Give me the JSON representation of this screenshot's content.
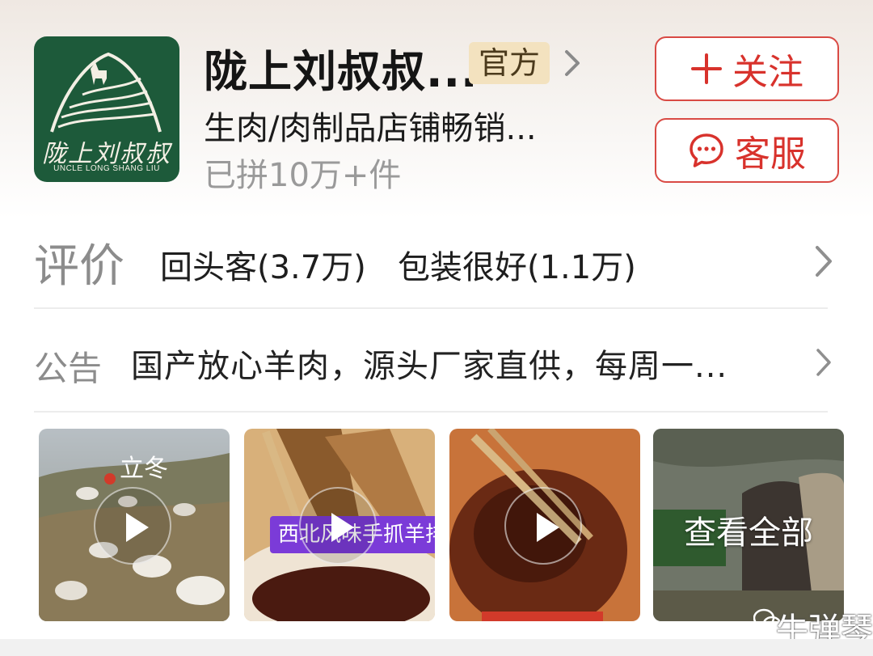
{
  "shop": {
    "name": "陇上刘叔叔...",
    "badge": "官方",
    "category": "生肉/肉制品店铺畅销...",
    "sales": "已拼10万+件",
    "logo_cn": "陇上刘叔叔",
    "logo_en": "UNCLE LONG SHANG LIU"
  },
  "actions": {
    "follow_label": "关注",
    "service_label": "客服"
  },
  "reviews": {
    "title": "评价",
    "tags": [
      "回头客(3.7万)",
      "包装很好(1.1万)"
    ]
  },
  "notice": {
    "title": "公告",
    "text": "国产放心羊肉，源头厂家直供，每周一..."
  },
  "media": {
    "thumb1_text": "立冬",
    "thumb2_caption": "西北风味手抓羊排",
    "view_all": "查看全部"
  },
  "watermark": "牛弹琴",
  "colors": {
    "accent": "#d8322c",
    "badge_bg": "#f3e2bf",
    "logo_bg": "#1d5a3a"
  },
  "icons": [
    "chevron-right-icon",
    "plus-icon",
    "chat-bubble-icon",
    "play-icon",
    "wechat-icon"
  ]
}
